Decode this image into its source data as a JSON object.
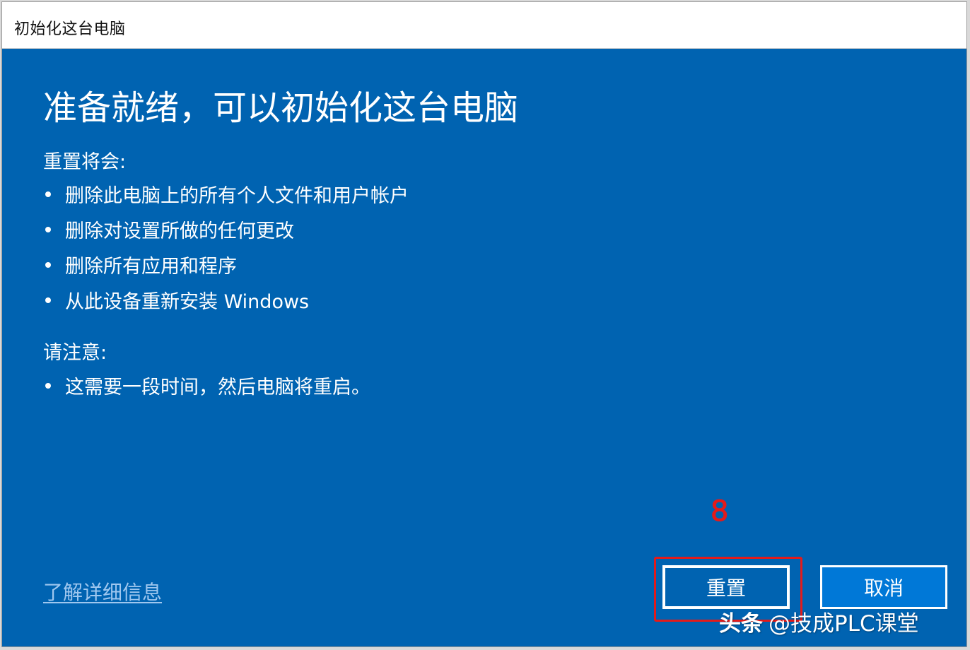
{
  "window": {
    "title": "初始化这台电脑"
  },
  "main": {
    "heading": "准备就绪，可以初始化这台电脑",
    "reset_section_label": "重置将会:",
    "reset_items": [
      "删除此电脑上的所有个人文件和用户帐户",
      "删除对设置所做的任何更改",
      "删除所有应用和程序",
      "从此设备重新安装 Windows"
    ],
    "note_section_label": "请注意:",
    "note_items": [
      "这需要一段时间，然后电脑将重启。"
    ],
    "learn_more_link": "了解详细信息"
  },
  "buttons": {
    "reset_label": "重置",
    "cancel_label": "取消"
  },
  "annotation": {
    "step_number": "8",
    "color": "#e31b1b"
  },
  "watermark": {
    "brand": "头条",
    "handle": "@技成PLC课堂"
  },
  "colors": {
    "background": "#0063b1",
    "titlebar": "#ffffff",
    "link": "#9fc7ef",
    "cancel_button": "#0078d7"
  }
}
